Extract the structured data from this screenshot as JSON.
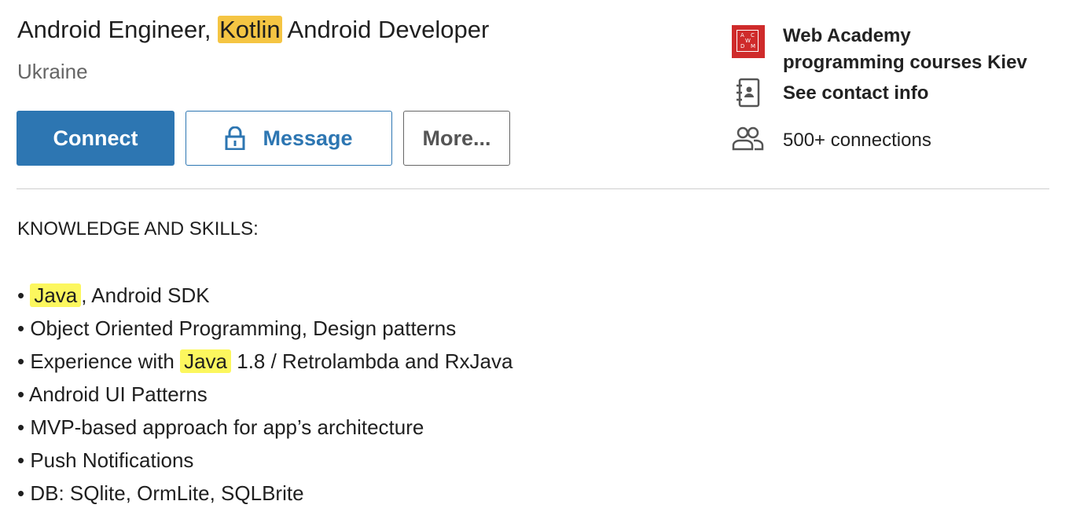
{
  "profile": {
    "headline_part1": "Android Engineer, ",
    "headline_highlight": "Kotlin",
    "headline_part2": " Android Developer",
    "location": "Ukraine"
  },
  "actions": {
    "connect_label": "Connect",
    "message_label": "Message",
    "more_label": "More..."
  },
  "sidebar": {
    "school_line1": "Web Academy",
    "school_line2": "programming courses Kiev",
    "contact_label": "See contact info",
    "connections_label": "500+ connections",
    "school_logo_text": [
      "A",
      "C",
      "W",
      "D",
      "M"
    ]
  },
  "about": {
    "heading": "KNOWLEDGE AND SKILLS:",
    "bullet": "•",
    "skills": [
      {
        "pre": " ",
        "highlight": "Java",
        "post": ", Android SDK"
      },
      {
        "pre": " Object Oriented Programming, Design patterns",
        "highlight": "",
        "post": ""
      },
      {
        "pre": " Experience with ",
        "highlight": "Java",
        "post": " 1.8 / Retrolambda and RxJava"
      },
      {
        "pre": " Android UI Patterns",
        "highlight": "",
        "post": ""
      },
      {
        "pre": " MVP-based approach for app’s architecture",
        "highlight": "",
        "post": ""
      },
      {
        "pre": " Push Notifications",
        "highlight": "",
        "post": ""
      },
      {
        "pre": " DB: SQlite, OrmLite, SQLBrite",
        "highlight": "",
        "post": ""
      }
    ]
  },
  "colors": {
    "primary": "#2d76b2",
    "highlight_orange": "#f5c543",
    "highlight_yellow": "#fcf75e",
    "school_logo": "#cf2b2b"
  },
  "icons": {
    "message": "lock-icon",
    "contact": "contact-book-icon",
    "connections": "people-icon"
  }
}
